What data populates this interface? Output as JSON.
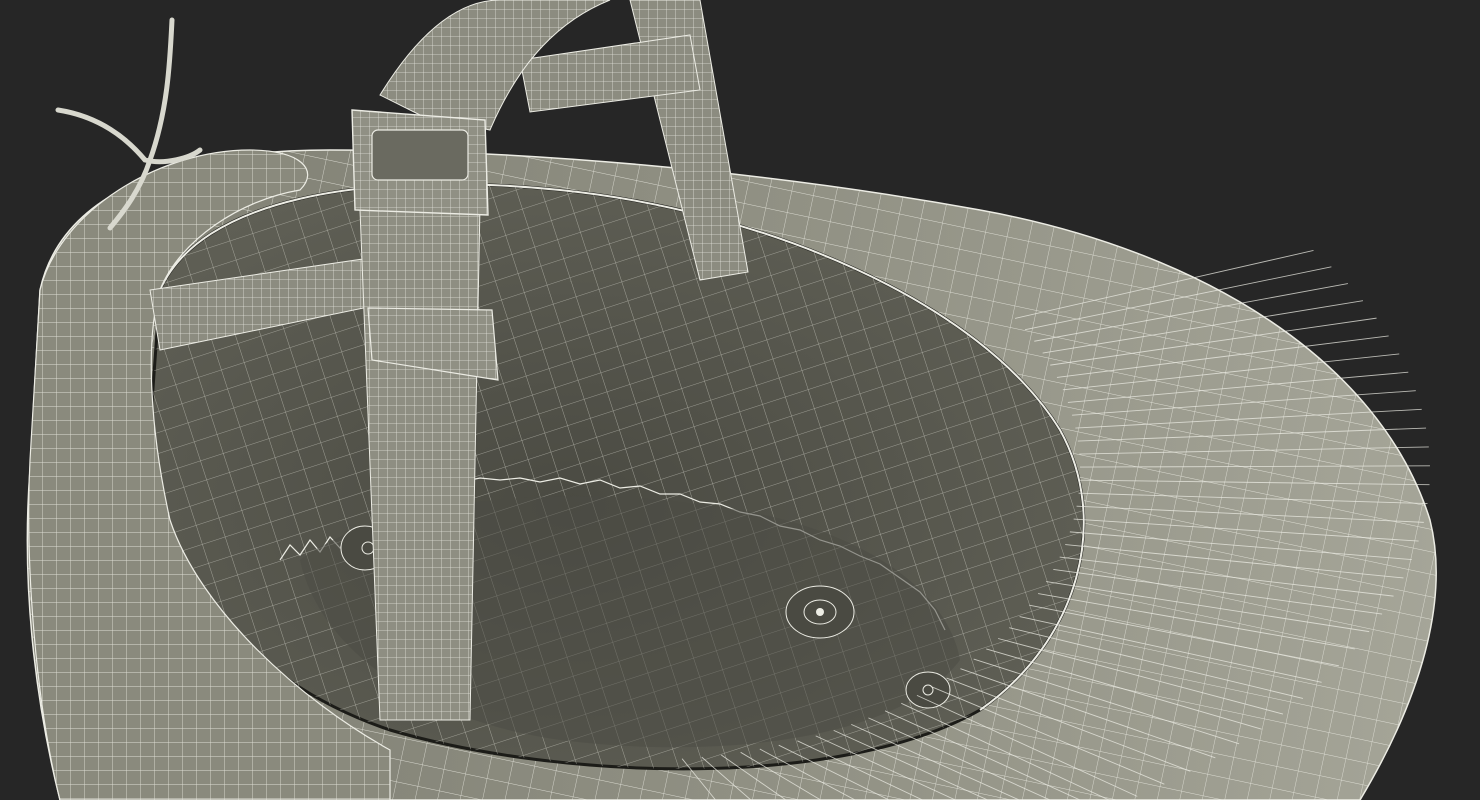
{
  "viewport": {
    "background_color": "#262626"
  },
  "model": {
    "subject": "helmet-wireframe",
    "render_style": "wireframe-on-shaded",
    "shell_color": "#8b8b7e",
    "shell_light_color": "#a3a396",
    "interior_color": "#5c5c52",
    "interior_dark_color": "#45453d",
    "wire_color": "#ecece4"
  }
}
